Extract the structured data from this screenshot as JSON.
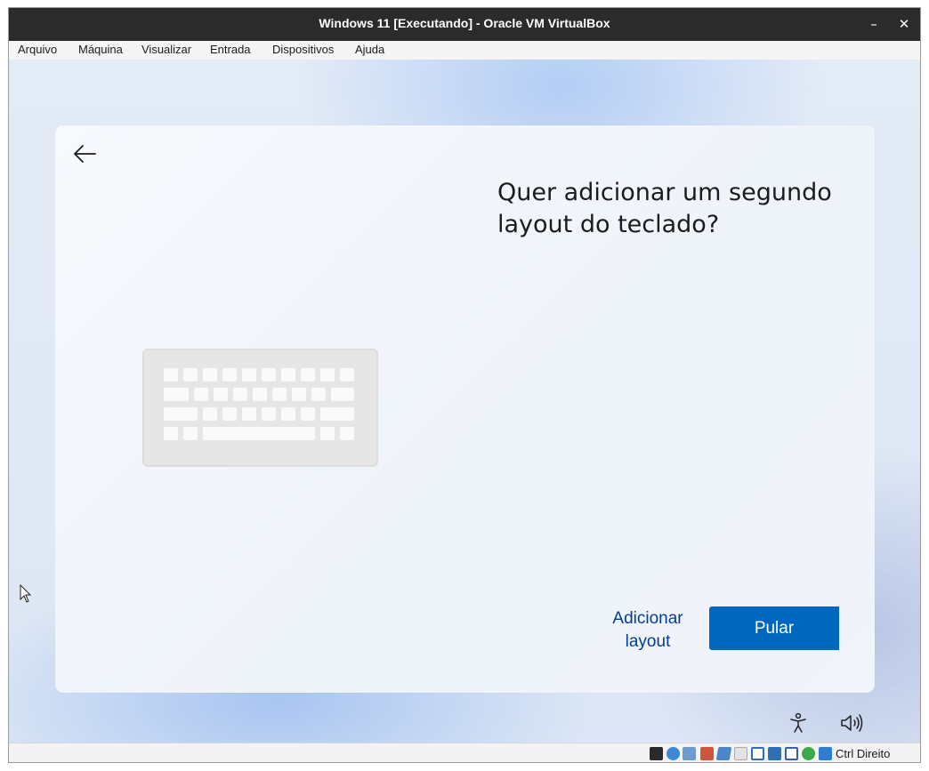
{
  "window": {
    "title": "Windows 11 [Executando] - Oracle VM VirtualBox",
    "minimize_symbol": "–",
    "close_symbol": "✕"
  },
  "menubar": {
    "items": [
      "Arquivo",
      "Máquina",
      "Visualizar",
      "Entrada",
      "Dispositivos",
      "Ajuda"
    ]
  },
  "oobe": {
    "heading": "Quer adicionar um segundo layout do teclado?",
    "add_layout_label": "Adicionar layout",
    "skip_label": "Pular",
    "back_icon": "arrow-left-icon",
    "illustration": "keyboard-illustration",
    "accent_color": "#0067c0",
    "link_color": "#003e92"
  },
  "taskbar_icons": [
    "accessibility-icon",
    "volume-icon"
  ],
  "statusbar": {
    "host_key_label": "Ctrl Direito",
    "icons": [
      "display-status-icon",
      "optical-drive-icon",
      "audio-icon",
      "network-icon",
      "usb-icon",
      "shared-folders-icon",
      "display-icon",
      "video-capture-icon",
      "cpu-icon",
      "virtualization-icon",
      "mouse-integration-icon",
      "guest-additions-icon"
    ]
  }
}
